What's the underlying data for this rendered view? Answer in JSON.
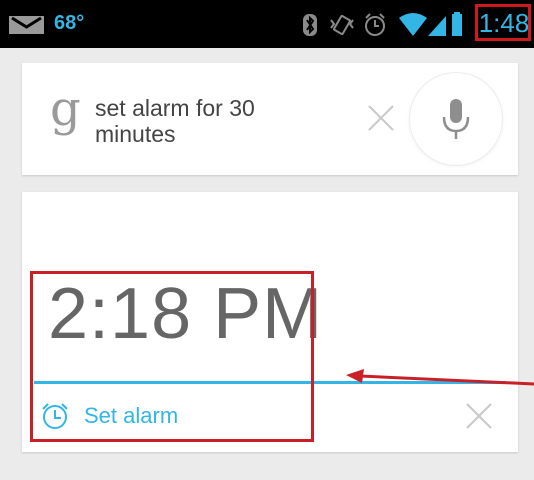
{
  "status_bar": {
    "temperature": "68°",
    "time": "1:48",
    "icons": [
      "gmail-icon",
      "bluetooth-icon",
      "vibrate-icon",
      "alarm-icon",
      "wifi-icon",
      "signal-icon",
      "battery-icon"
    ]
  },
  "search": {
    "logo": "g",
    "query": "set alarm for 30 minutes"
  },
  "alarm_card": {
    "time": "2:18 PM",
    "action_label": "Set alarm"
  },
  "colors": {
    "accent": "#33b5e5",
    "annotation": "#d0191f",
    "background": "#ebebeb"
  }
}
